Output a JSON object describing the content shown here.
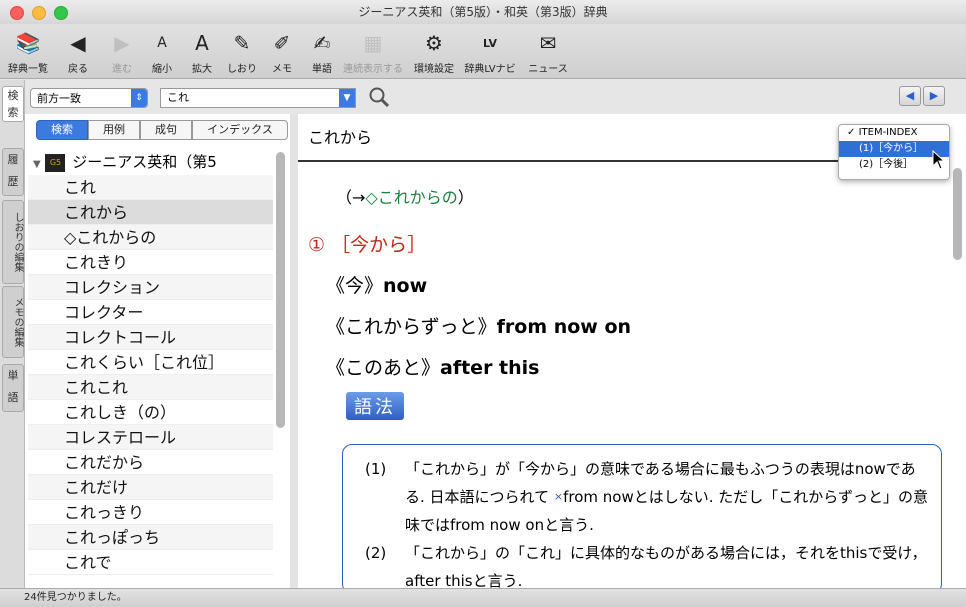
{
  "window": {
    "title": "ジーニアス英和（第5版）・和英（第3版）辞典"
  },
  "colors": {
    "accent": "#3b7be0",
    "sense_red": "#c0281a",
    "ref_green": "#1a7f3a"
  },
  "toolbar": [
    {
      "label": "辞典一覧",
      "icon": "books-icon",
      "enabled": true
    },
    {
      "label": "戻る",
      "icon": "back-arrow-icon",
      "enabled": true
    },
    {
      "label": "進む",
      "icon": "forward-arrow-icon",
      "enabled": false
    },
    {
      "label": "縮小",
      "icon": "font-smaller-icon",
      "enabled": true
    },
    {
      "label": "拡大",
      "icon": "font-larger-icon",
      "enabled": true
    },
    {
      "label": "しおり",
      "icon": "bookmark-icon",
      "enabled": true
    },
    {
      "label": "メモ",
      "icon": "memo-icon",
      "enabled": true
    },
    {
      "label": "単語",
      "icon": "word-icon",
      "enabled": true
    },
    {
      "label": "連続表示する",
      "icon": "continuous-display-icon",
      "enabled": false
    },
    {
      "label": "環境設定",
      "icon": "preferences-icon",
      "enabled": true
    },
    {
      "label": "辞典LVナビ",
      "icon": "lv-navi-icon",
      "enabled": true
    },
    {
      "label": "ニュース",
      "icon": "mailbox-icon",
      "enabled": true
    }
  ],
  "side_tabs": [
    "検",
    "索",
    "履",
    "歴",
    "しおりの編集",
    "メモの編集",
    "単",
    "語"
  ],
  "search": {
    "mode": "前方一致",
    "query": "これ"
  },
  "segments": [
    "検索",
    "用例",
    "成句",
    "インデックス"
  ],
  "dictionary_name": "ジーニアス英和（第5",
  "entries": [
    "これ",
    "これから",
    "◇これからの",
    "これきり",
    "コレクション",
    "コレクター",
    "コレクトコール",
    "これくらい［これ位］",
    "これこれ",
    "これしき（の）",
    "コレステロール",
    "これだから",
    "これだけ",
    "これっきり",
    "これっぽっち",
    "これで"
  ],
  "selected_entry": "これから",
  "headword": "これから",
  "popup": {
    "title": "ITEM-INDEX",
    "items": [
      "(1)［今から］",
      "(2)［今後］"
    ],
    "selected": 0
  },
  "content": {
    "ref_open": "（→",
    "ref_link": "◇これからの",
    "ref_close": "）",
    "sense": "① ［今から］",
    "translations": [
      {
        "jp": "《今》",
        "en": "now"
      },
      {
        "jp": "《これからずっと》",
        "en": "from now on"
      },
      {
        "jp": "《このあと》",
        "en": "after this"
      }
    ],
    "usage_label": "語法",
    "usage": [
      {
        "num": "(1)",
        "text_a": "「これから」が「今から」の意味である場合に最もふつうの表現はnowである. 日本語につられて ",
        "cross": "×",
        "text_b": "from nowとはしない. ただし「これからずっと」の意味ではfrom now onと言う."
      },
      {
        "num": "(2)",
        "text_a": "「これから」の「これ」に具体的なものがある場合には，それをthisで受け，after thisと言う.",
        "cross": "",
        "text_b": ""
      }
    ]
  },
  "status": "24件見つかりました。"
}
